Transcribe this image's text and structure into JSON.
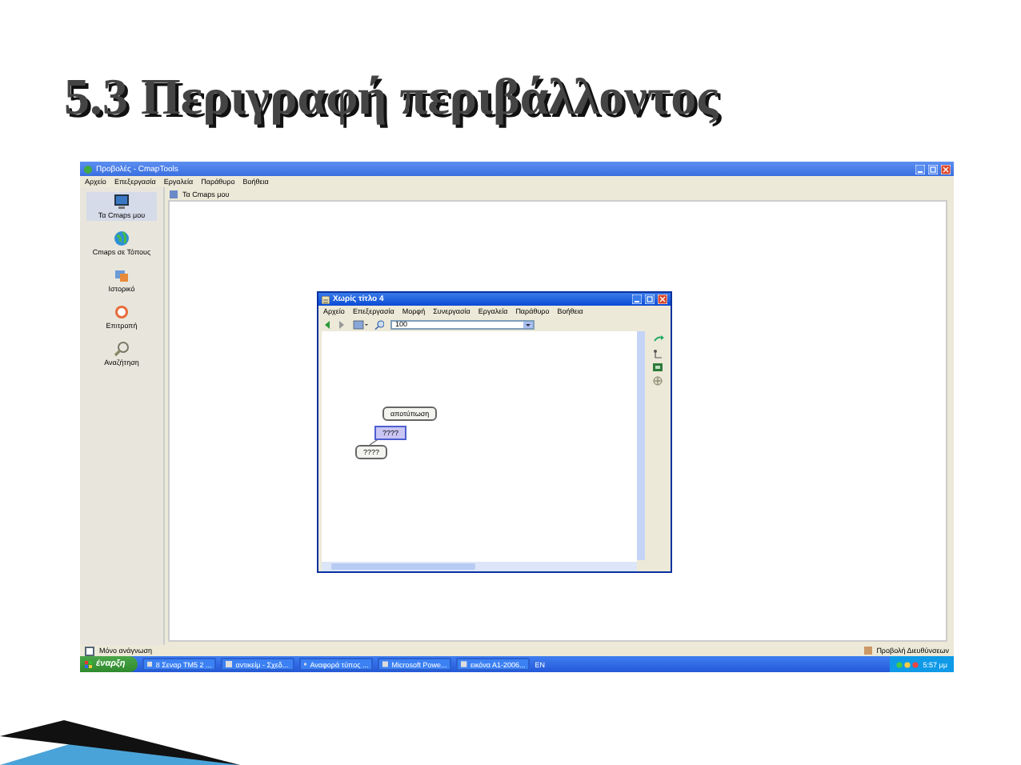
{
  "slide_title": "5.3 Περιγραφή περιβάλλοντος",
  "app": {
    "title": "Προβολές - CmapTools",
    "menu": [
      "Αρχείο",
      "Επεξεργασία",
      "Εργαλεία",
      "Παράθυρο",
      "Βοήθεια"
    ],
    "sidebar": [
      {
        "label": "Τα Cmaps μου",
        "selected": true
      },
      {
        "label": "Cmaps σε Τόπους",
        "selected": false
      },
      {
        "label": "Ιστορικό",
        "selected": false
      },
      {
        "label": "Επιτροπή",
        "selected": false
      },
      {
        "label": "Αναζήτηση",
        "selected": false
      }
    ],
    "path": "Τα Cmaps μου",
    "readonly": {
      "label": "Μόνο ανάγνωση",
      "checked": false
    },
    "status": "Προβολή Διευθύνσεων"
  },
  "map_window": {
    "title": "Χωρίς τίτλο 4",
    "menu": [
      "Αρχείο",
      "Επεξεργασία",
      "Μορφή",
      "Συνεργασία",
      "Εργαλεία",
      "Παράθυρο",
      "Βοήθεια"
    ],
    "zoom": "100",
    "nodes": [
      {
        "label": "αποτύπωση",
        "kind": "concept",
        "selected": false
      },
      {
        "label": "????",
        "kind": "link",
        "selected": true
      },
      {
        "label": "????",
        "kind": "concept",
        "selected": false
      }
    ]
  },
  "taskbar": {
    "start": "έναρξη",
    "tasks": [
      "8 Σεναρ ΤΜ5 2 ...",
      "αντικείμ - Σχεδ...",
      "Αναφορά τύπος ...",
      "Microsoft Powe...",
      "εικόνα Α1-2006..."
    ],
    "language": "EN",
    "clock": "5:57 μμ"
  }
}
